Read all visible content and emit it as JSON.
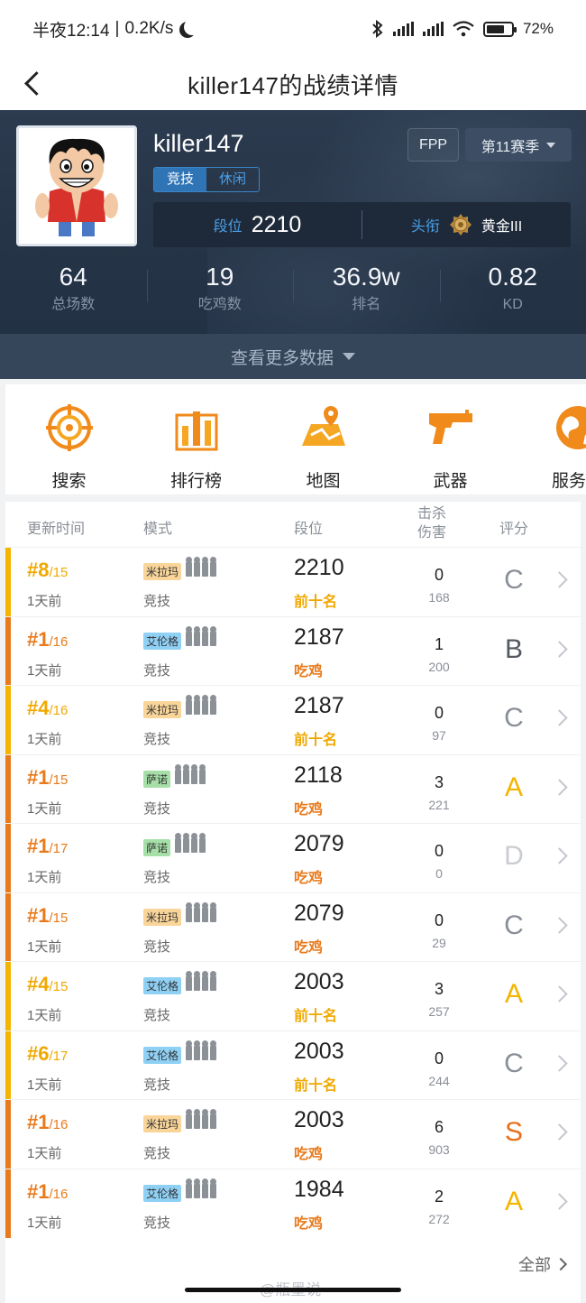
{
  "status_bar": {
    "time": "半夜12:14",
    "speed": "0.2K/s",
    "battery": "72",
    "battery_level": 0.72
  },
  "nav": {
    "title": "killer147的战绩详情"
  },
  "profile": {
    "username": "killer147",
    "tabs": [
      "竞技",
      "休闲"
    ],
    "view": "FPP",
    "season": "第11赛季",
    "rank_label": "段位",
    "rank_value": "2210",
    "title_label": "头衔",
    "title_value": "黄金III"
  },
  "stats": [
    {
      "value": "64",
      "label": "总场数"
    },
    {
      "value": "19",
      "label": "吃鸡数"
    },
    {
      "value": "36.9w",
      "label": "排名"
    },
    {
      "value": "0.82",
      "label": "KD"
    }
  ],
  "more_data": "查看更多数据",
  "features": [
    {
      "icon": "crosshair-icon",
      "label": "搜索"
    },
    {
      "icon": "bar-chart-icon",
      "label": "排行榜"
    },
    {
      "icon": "map-icon",
      "label": "地图"
    },
    {
      "icon": "gun-icon",
      "label": "武器"
    },
    {
      "icon": "globe-icon",
      "label": "服务器"
    }
  ],
  "table_headers": {
    "time": "更新时间",
    "mode": "模式",
    "rating": "段位",
    "kills": "击杀",
    "damage": "伤害",
    "grade": "评分"
  },
  "colors": {
    "orange": "#e87a1c",
    "yellow": "#f5b400",
    "blue_accent": "#4aa0e8",
    "map_erangel": "#8fd0f5",
    "map_miramar": "#f9d59a",
    "map_sanhok": "#a6e0a8"
  },
  "matches": [
    {
      "place": "#8",
      "total": "/15",
      "ago": "1天前",
      "map": "米拉玛",
      "map_key": "miramar",
      "mode": "竞技",
      "rating": "2210",
      "result": "前十名",
      "kills": "0",
      "damage": "168",
      "grade": "C",
      "win": false
    },
    {
      "place": "#1",
      "total": "/16",
      "ago": "1天前",
      "map": "艾伦格",
      "map_key": "erangel",
      "mode": "竞技",
      "rating": "2187",
      "result": "吃鸡",
      "kills": "1",
      "damage": "200",
      "grade": "B",
      "win": true
    },
    {
      "place": "#4",
      "total": "/16",
      "ago": "1天前",
      "map": "米拉玛",
      "map_key": "miramar",
      "mode": "竞技",
      "rating": "2187",
      "result": "前十名",
      "kills": "0",
      "damage": "97",
      "grade": "C",
      "win": false
    },
    {
      "place": "#1",
      "total": "/15",
      "ago": "1天前",
      "map": "萨诺",
      "map_key": "sanhok",
      "mode": "竞技",
      "rating": "2118",
      "result": "吃鸡",
      "kills": "3",
      "damage": "221",
      "grade": "A",
      "win": true
    },
    {
      "place": "#1",
      "total": "/17",
      "ago": "1天前",
      "map": "萨诺",
      "map_key": "sanhok",
      "mode": "竞技",
      "rating": "2079",
      "result": "吃鸡",
      "kills": "0",
      "damage": "0",
      "grade": "D",
      "win": true
    },
    {
      "place": "#1",
      "total": "/15",
      "ago": "1天前",
      "map": "米拉玛",
      "map_key": "miramar",
      "mode": "竞技",
      "rating": "2079",
      "result": "吃鸡",
      "kills": "0",
      "damage": "29",
      "grade": "C",
      "win": true
    },
    {
      "place": "#4",
      "total": "/15",
      "ago": "1天前",
      "map": "艾伦格",
      "map_key": "erangel",
      "mode": "竞技",
      "rating": "2003",
      "result": "前十名",
      "kills": "3",
      "damage": "257",
      "grade": "A",
      "win": false
    },
    {
      "place": "#6",
      "total": "/17",
      "ago": "1天前",
      "map": "艾伦格",
      "map_key": "erangel",
      "mode": "竞技",
      "rating": "2003",
      "result": "前十名",
      "kills": "0",
      "damage": "244",
      "grade": "C",
      "win": false
    },
    {
      "place": "#1",
      "total": "/16",
      "ago": "1天前",
      "map": "米拉玛",
      "map_key": "miramar",
      "mode": "竞技",
      "rating": "2003",
      "result": "吃鸡",
      "kills": "6",
      "damage": "903",
      "grade": "S",
      "win": true
    },
    {
      "place": "#1",
      "total": "/16",
      "ago": "1天前",
      "map": "艾伦格",
      "map_key": "erangel",
      "mode": "竞技",
      "rating": "1984",
      "result": "吃鸡",
      "kills": "2",
      "damage": "272",
      "grade": "A",
      "win": true
    }
  ],
  "all_link": "全部",
  "watermark": "@瓶墨说"
}
